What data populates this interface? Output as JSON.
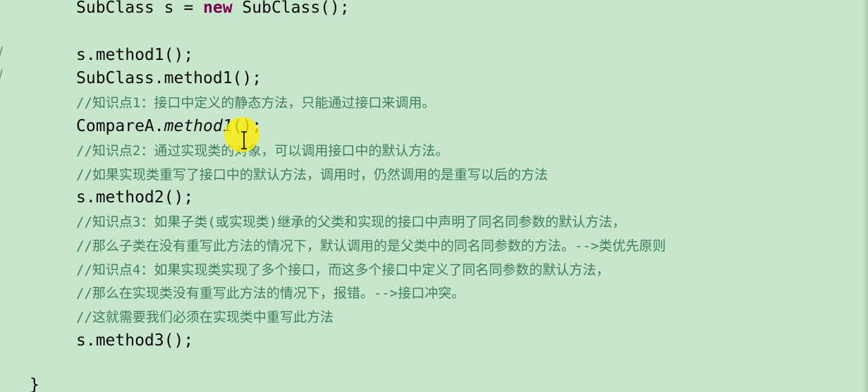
{
  "editor": {
    "lines": {
      "l1_a": "SubClass s = ",
      "l1_kw": "new",
      "l1_b": " SubClass();",
      "l2": "s.method1();",
      "l3": "SubClass.method1();",
      "l4": "//知识点1：接口中定义的静态方法，只能通过接口来调用。",
      "l5_a": "CompareA.",
      "l5_b": "method1",
      "l5_c": "();",
      "l6": "//知识点2：通过实现类的对象，可以调用接口中的默认方法。",
      "l7": "//如果实现类重写了接口中的默认方法，调用时，仍然调用的是重写以后的方法",
      "l8": "s.method2();",
      "l9": "//知识点3：如果子类(或实现类)继承的父类和实现的接口中声明了同名同参数的默认方法，",
      "l10": "//那么子类在没有重写此方法的情况下，默认调用的是父类中的同名同参数的方法。-->类优先原则",
      "l11": "//知识点4：如果实现类实现了多个接口，而这多个接口中定义了同名同参数的默认方法，",
      "l12": "//那么在实现类没有重写此方法的情况下，报错。-->接口冲突。",
      "l13": "//这就需要我们必须在实现类中重写此方法",
      "l14": "s.method3();",
      "brace": "}"
    },
    "colors": {
      "background": "#c7e6cb",
      "keyword": "#7b0052",
      "comment": "#3f7f5f",
      "highlight": "#ffec00"
    }
  }
}
